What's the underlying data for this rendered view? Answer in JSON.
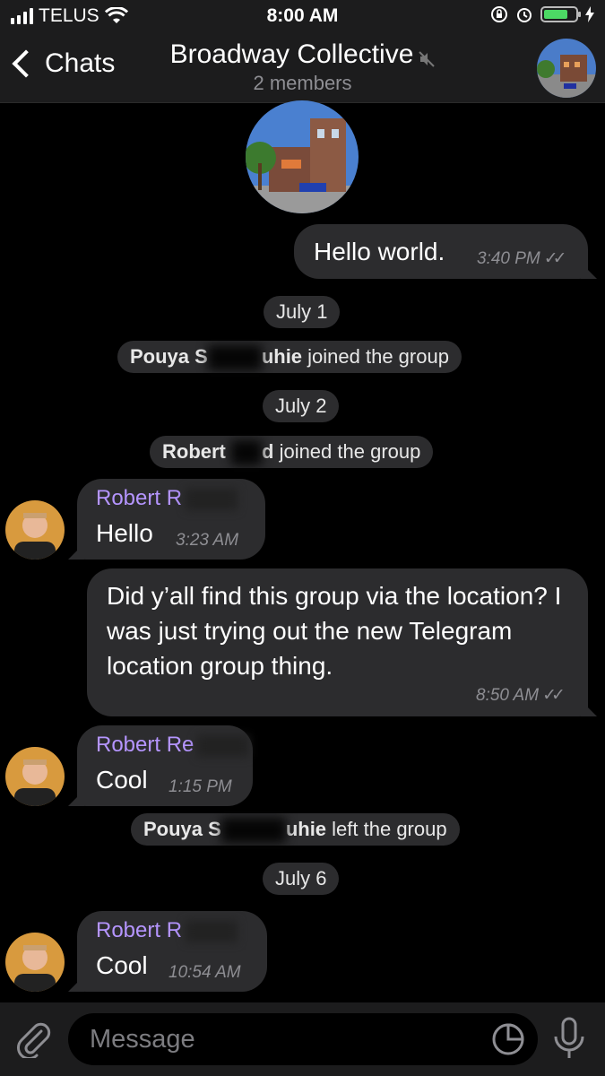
{
  "status_bar": {
    "carrier": "TELUS",
    "time": "8:00 AM",
    "icons": [
      "signal-icon",
      "wifi-icon",
      "rotation-lock-icon",
      "alarm-icon",
      "battery-icon",
      "charging-icon"
    ],
    "battery_level": 0.75,
    "battery_color": "#4cd964"
  },
  "nav": {
    "back_label": "Chats",
    "title": "Broadway Collective",
    "subtitle": "2 members",
    "muted": true
  },
  "messages": [
    {
      "type": "out",
      "text": "Hello world.",
      "time": "3:40 PM",
      "read": true
    },
    {
      "type": "date",
      "text": "July 1"
    },
    {
      "type": "service",
      "name": "Pouya S",
      "name_end": "uhie",
      "action": " joined the group"
    },
    {
      "type": "date",
      "text": "July 2"
    },
    {
      "type": "service",
      "name": "Robert ",
      "name_end": "d",
      "action": " joined the group"
    },
    {
      "type": "in",
      "sender": "Robert R",
      "text": "Hello",
      "time": "3:23 AM"
    },
    {
      "type": "out",
      "text": "Did y’all find this group via the location? I was just trying out the new Telegram location group thing.",
      "time": "8:50 AM",
      "read": true
    },
    {
      "type": "in",
      "sender": "Robert Re",
      "text": "Cool",
      "time": "1:15 PM"
    },
    {
      "type": "service",
      "name": "Pouya S",
      "name_end": "uhie",
      "action": " left the group"
    },
    {
      "type": "date",
      "text": "July 6"
    },
    {
      "type": "in",
      "sender": "Robert R",
      "text": "Cool",
      "time": "10:54 AM"
    }
  ],
  "input": {
    "placeholder": "Message",
    "value": ""
  },
  "colors": {
    "background": "#000000",
    "bubble": "#2c2c2e",
    "sender_name": "#b595ff",
    "bar": "#1c1c1d"
  }
}
